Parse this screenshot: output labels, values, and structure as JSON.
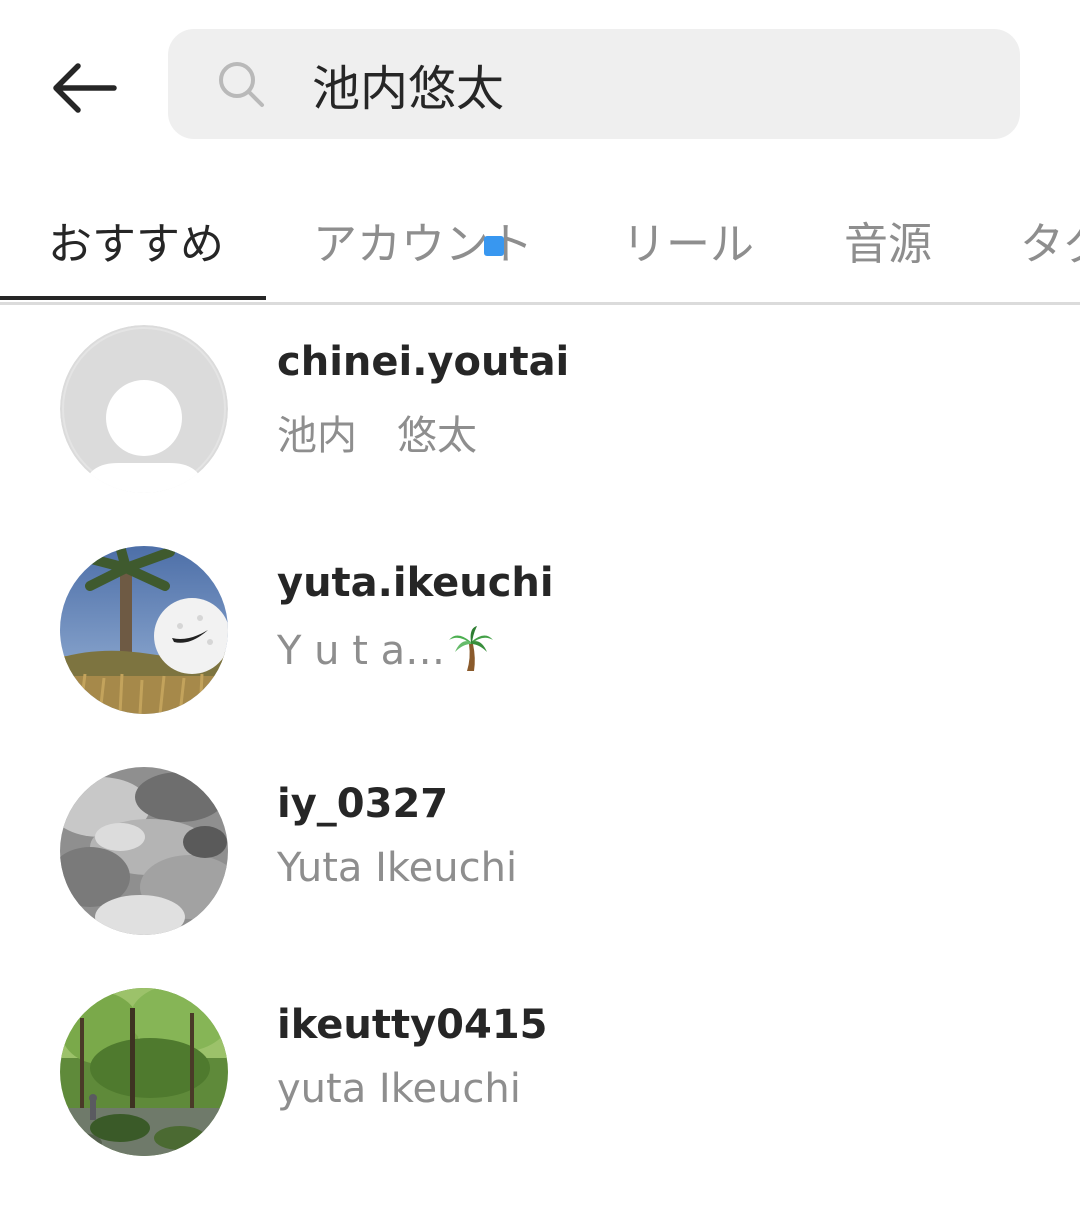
{
  "search": {
    "query": "池内悠太"
  },
  "tabs": [
    {
      "label": "おすすめ",
      "active": true
    },
    {
      "label": "アカウント",
      "active": false
    },
    {
      "label": "リール",
      "active": false
    },
    {
      "label": "音源",
      "active": false
    },
    {
      "label": "タグ",
      "active": false
    }
  ],
  "results": [
    {
      "username": "chinei.youtai",
      "full_name": "池内　悠太",
      "avatar": "default-avatar"
    },
    {
      "username": "yuta.ikeuchi",
      "full_name": "Y u t a…",
      "avatar": "golf-ball-photo",
      "name_icon": "palm-tree-emoji"
    },
    {
      "username": "iy_0327",
      "full_name": "Yuta Ikeuchi",
      "avatar": "cloudy-sky-photo"
    },
    {
      "username": "ikeutty0415",
      "full_name": "yuta Ikeuchi",
      "avatar": "forest-river-photo"
    }
  ],
  "colors": {
    "primary_text": "#262626",
    "secondary_text": "#8e8e8e",
    "search_bg": "#efefef",
    "notification_dot": "#3897f0",
    "divider": "#dbdbdb"
  }
}
